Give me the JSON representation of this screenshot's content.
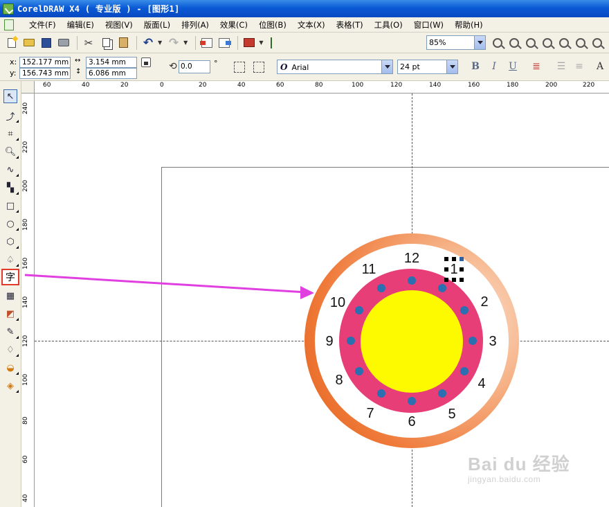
{
  "window": {
    "title": "CorelDRAW X4 ( 专业版 ) - [图形1]"
  },
  "menu": [
    "文件(F)",
    "编辑(E)",
    "视图(V)",
    "版面(L)",
    "排列(A)",
    "效果(C)",
    "位图(B)",
    "文本(X)",
    "表格(T)",
    "工具(O)",
    "窗口(W)",
    "帮助(H)"
  ],
  "standard_toolbar": {
    "zoom_value": "85%"
  },
  "property_bar": {
    "x_label": "x:",
    "y_label": "y:",
    "x_value": "152.177 mm",
    "y_value": "156.743 mm",
    "width_value": "3.154 mm",
    "height_value": "6.086 mm",
    "rotation_value": "0.0",
    "rotation_unit": "°",
    "font_name": "Arial",
    "font_icon": "O",
    "font_size": "24 pt",
    "bold_label": "B",
    "italic_label": "I",
    "underline_label": "U"
  },
  "toolbox": {
    "text_tool_label": "字"
  },
  "rulers": {
    "horizontal": [
      "60",
      "40",
      "20",
      "0",
      "20",
      "40",
      "60",
      "80",
      "100",
      "120",
      "140",
      "160",
      "180",
      "200",
      "220"
    ],
    "vertical": [
      "240",
      "220",
      "200",
      "180",
      "160",
      "140",
      "120",
      "100",
      "80",
      "60",
      "40"
    ]
  },
  "clock": {
    "numerals": [
      "12",
      "1",
      "2",
      "3",
      "4",
      "5",
      "6",
      "7",
      "8",
      "9",
      "10",
      "11"
    ],
    "colors": {
      "outer_ring": "#ef7a3a",
      "inner_band": "#e83e78",
      "center": "#fdfa00",
      "dots": "#2b6fb0"
    }
  },
  "annotation": {
    "arrow_color": "#e040e0",
    "highlight_color": "#e23a2a"
  },
  "watermark": {
    "main": "Bai du 经验",
    "sub": "jingyan.baidu.com"
  }
}
